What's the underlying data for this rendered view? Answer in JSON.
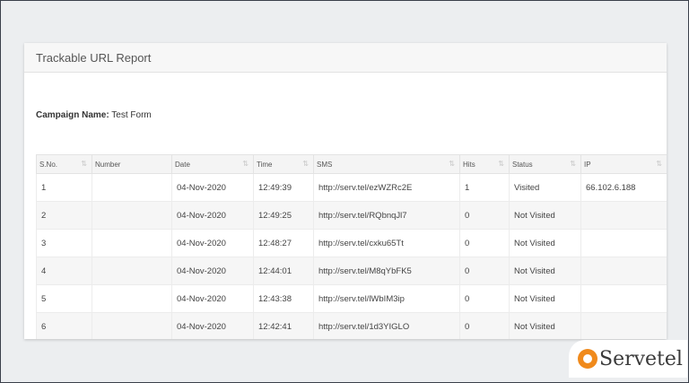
{
  "report": {
    "title": "Trackable URL Report",
    "campaign_label": "Campaign Name:",
    "campaign_value": "Test Form"
  },
  "table": {
    "columns": [
      "S.No.",
      "Number",
      "Date",
      "Time",
      "SMS",
      "Hits",
      "Status",
      "IP"
    ],
    "rows": [
      [
        "1",
        "",
        "04-Nov-2020",
        "12:49:39",
        "http://serv.tel/ezWZRc2E",
        "1",
        "Visited",
        "66.102.6.188"
      ],
      [
        "2",
        "",
        "04-Nov-2020",
        "12:49:25",
        "http://serv.tel/RQbnqJl7",
        "0",
        "Not Visited",
        ""
      ],
      [
        "3",
        "",
        "04-Nov-2020",
        "12:48:27",
        "http://serv.tel/cxku65Tt",
        "0",
        "Not Visited",
        ""
      ],
      [
        "4",
        "",
        "04-Nov-2020",
        "12:44:01",
        "http://serv.tel/M8qYbFK5",
        "0",
        "Not Visited",
        ""
      ],
      [
        "5",
        "",
        "04-Nov-2020",
        "12:43:38",
        "http://serv.tel/lWbIM3ip",
        "0",
        "Not Visited",
        ""
      ],
      [
        "6",
        "",
        "04-Nov-2020",
        "12:42:41",
        "http://serv.tel/1d3YIGLO",
        "0",
        "Not Visited",
        ""
      ]
    ]
  },
  "brand": {
    "name": "Servetel",
    "accent": "#f08a1c"
  },
  "icons": {
    "sort": "sort-icon",
    "logo": "servetel-logo-icon"
  }
}
